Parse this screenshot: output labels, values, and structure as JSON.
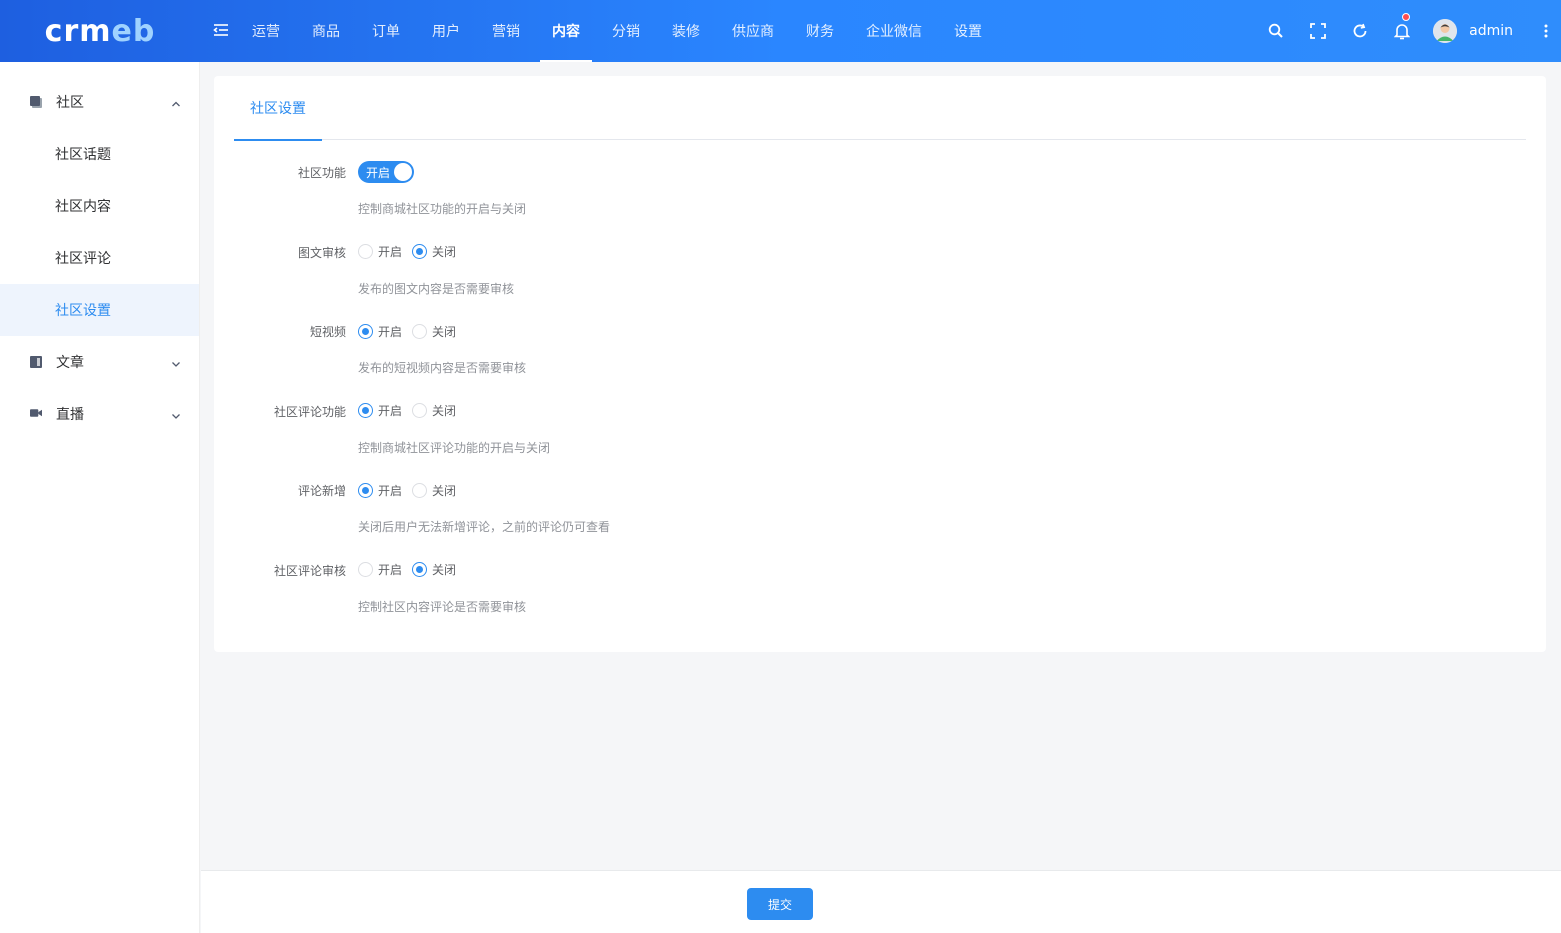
{
  "brand": {
    "logo_main": "crm",
    "logo_accent": "eb"
  },
  "top_nav": [
    {
      "label": "运营"
    },
    {
      "label": "商品"
    },
    {
      "label": "订单"
    },
    {
      "label": "用户"
    },
    {
      "label": "营销"
    },
    {
      "label": "内容",
      "active": true
    },
    {
      "label": "分销"
    },
    {
      "label": "装修"
    },
    {
      "label": "供应商"
    },
    {
      "label": "财务"
    },
    {
      "label": "企业微信"
    },
    {
      "label": "设置"
    }
  ],
  "header_right": {
    "username": "admin",
    "icons": [
      "search-icon",
      "fullscreen-icon",
      "refresh-icon",
      "bell-icon",
      "more-vertical-icon"
    ]
  },
  "sidebar": {
    "groups": [
      {
        "label": "社区",
        "icon": "community-icon",
        "expanded": true,
        "items": [
          {
            "label": "社区话题"
          },
          {
            "label": "社区内容"
          },
          {
            "label": "社区评论"
          },
          {
            "label": "社区设置",
            "active": true
          }
        ]
      },
      {
        "label": "文章",
        "icon": "article-icon",
        "expanded": false
      },
      {
        "label": "直播",
        "icon": "video-camera-icon",
        "expanded": false
      }
    ]
  },
  "tabs": [
    {
      "label": "社区设置"
    }
  ],
  "form": {
    "items": [
      {
        "label": "社区功能",
        "type": "switch",
        "switch_text": "开启",
        "desc": "控制商城社区功能的开启与关闭"
      },
      {
        "label": "图文审核",
        "type": "radio",
        "options": [
          "开启",
          "关闭"
        ],
        "selected": 1,
        "desc": "发布的图文内容是否需要审核"
      },
      {
        "label": "短视频",
        "type": "radio",
        "options": [
          "开启",
          "关闭"
        ],
        "selected": 0,
        "desc": "发布的短视频内容是否需要审核"
      },
      {
        "label": "社区评论功能",
        "type": "radio",
        "options": [
          "开启",
          "关闭"
        ],
        "selected": 0,
        "desc": "控制商城社区评论功能的开启与关闭"
      },
      {
        "label": "评论新增",
        "type": "radio",
        "options": [
          "开启",
          "关闭"
        ],
        "selected": 0,
        "desc": "关闭后用户无法新增评论，之前的评论仍可查看"
      },
      {
        "label": "社区评论审核",
        "type": "radio",
        "options": [
          "开启",
          "关闭"
        ],
        "selected": 1,
        "desc": "控制社区内容评论是否需要审核"
      }
    ]
  },
  "footer": {
    "submit_label": "提交"
  },
  "colors": {
    "primary": "#2d8cf0",
    "header_start": "#1e5fe0",
    "header_end": "#2f8dfc"
  }
}
